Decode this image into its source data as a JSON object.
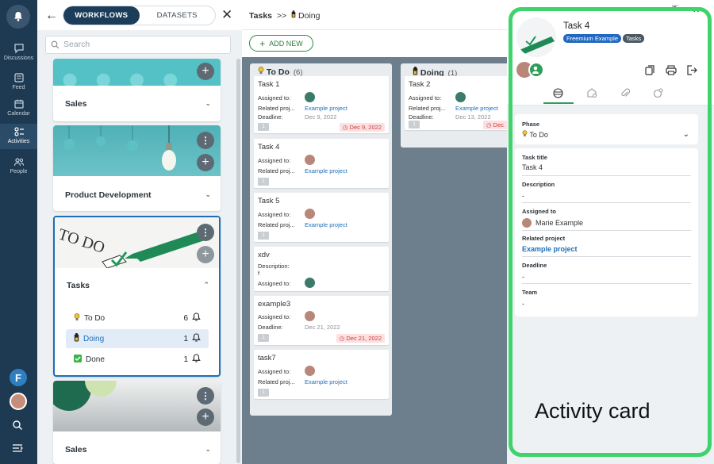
{
  "rail": {
    "items": [
      {
        "label": "Discussions"
      },
      {
        "label": "Feed"
      },
      {
        "label": "Calendar"
      },
      {
        "label": "Activities"
      },
      {
        "label": "People"
      }
    ],
    "user_initial": "F"
  },
  "workflows": {
    "tabs": {
      "active": "WORKFLOWS",
      "inactive": "DATASETS"
    },
    "search_placeholder": "Search",
    "cards": [
      {
        "title": "Sales"
      },
      {
        "title": "Product Development"
      },
      {
        "title": "Tasks",
        "phases": [
          {
            "icon": "lightbulb-icon",
            "label": "To Do",
            "count": "6"
          },
          {
            "icon": "battery-icon",
            "label": "Doing",
            "count": "1"
          },
          {
            "icon": "checkbox-icon",
            "label": "Done",
            "count": "1"
          }
        ]
      },
      {
        "title": "Sales"
      }
    ]
  },
  "board": {
    "breadcrumb": {
      "root": "Tasks",
      "sep": ">>",
      "current": "Doing"
    },
    "add_new": "ADD NEW",
    "columns": [
      {
        "name": "To Do",
        "count": "(6)"
      },
      {
        "name": "Doing",
        "count": "(1)"
      }
    ],
    "labels": {
      "assigned": "Assigned to:",
      "related": "Related proj...",
      "deadline": "Deadline:",
      "description": "Description:",
      "project": "Example project",
      "badge": "1"
    },
    "cards": [
      {
        "name": "Task 1",
        "deadline": "Dec 9, 2022",
        "due": "Dec 9, 2022"
      },
      {
        "name": "Task 4"
      },
      {
        "name": "Task 5"
      },
      {
        "name": "xdv",
        "description": "f"
      },
      {
        "name": "example3",
        "deadline": "Dec 21, 2022",
        "due": "Dec 21, 2022"
      },
      {
        "name": "task7"
      },
      {
        "name": "Task 2",
        "deadline": "Dec 13, 2022",
        "due": "Dec"
      }
    ]
  },
  "panel": {
    "title": "Task 4",
    "tags": [
      "Freemium Example",
      "Tasks"
    ],
    "fields": {
      "phase_label": "Phase",
      "phase_value": "To Do",
      "title_label": "Task title",
      "title_value": "Task 4",
      "desc_label": "Description",
      "desc_value": "-",
      "assigned_label": "Assigned to",
      "assigned_value": "Marie Example",
      "project_label": "Related project",
      "project_value": "Example project",
      "deadline_label": "Deadline",
      "deadline_value": "-",
      "team_label": "Team",
      "team_value": "-"
    }
  },
  "caption": "Activity card",
  "colors": {
    "rail": "#1e3a52",
    "accent_green": "#3fd36b",
    "link_blue": "#1f6fb8",
    "board_bg": "#6d7e8c"
  }
}
